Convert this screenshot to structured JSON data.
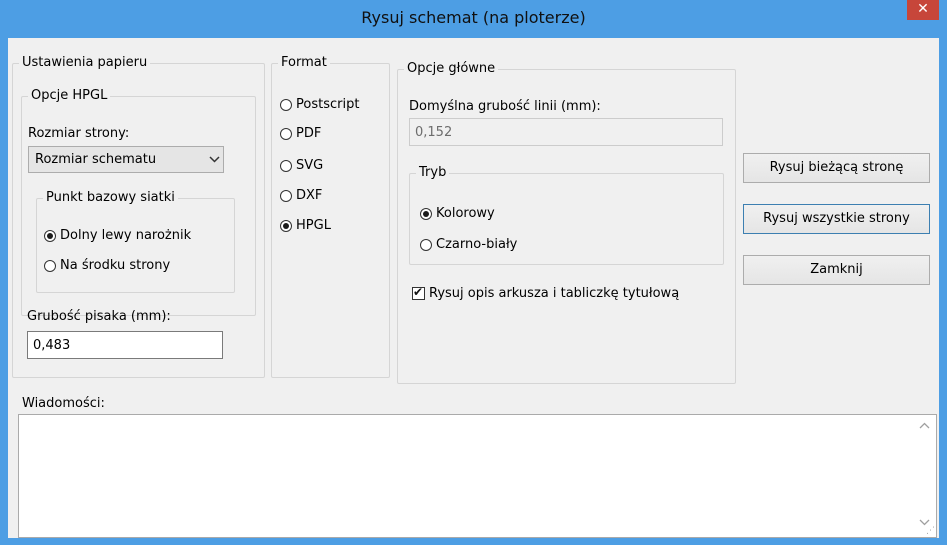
{
  "window": {
    "title": "Rysuj schemat (na ploterze)",
    "close_glyph": "✕"
  },
  "paper": {
    "legend": "Ustawienia papieru",
    "hpgl": {
      "legend": "Opcje HPGL",
      "page_size_label": "Rozmiar strony:",
      "page_size_value": "Rozmiar schematu",
      "grid_origin": {
        "legend": "Punkt bazowy siatki",
        "options": [
          {
            "label": "Dolny lewy narożnik",
            "checked": true
          },
          {
            "label": "Na środku strony",
            "checked": false
          }
        ]
      }
    },
    "pen_width_label": "Grubość pisaka (mm):",
    "pen_width_value": "0,483"
  },
  "format": {
    "legend": "Format",
    "options": [
      {
        "label": "Postscript",
        "checked": false
      },
      {
        "label": "PDF",
        "checked": false
      },
      {
        "label": "SVG",
        "checked": false
      },
      {
        "label": "DXF",
        "checked": false
      },
      {
        "label": "HPGL",
        "checked": true
      }
    ]
  },
  "main_options": {
    "legend": "Opcje główne",
    "line_width_label": "Domyślna grubość linii (mm):",
    "line_width_value": "0,152",
    "mode": {
      "legend": "Tryb",
      "options": [
        {
          "label": "Kolorowy",
          "checked": true
        },
        {
          "label": "Czarno-biały",
          "checked": false
        }
      ]
    },
    "frame_checkbox_label": "Rysuj opis arkusza i tabliczkę tytułową",
    "frame_checkbox_checked": true
  },
  "buttons": {
    "current_page": "Rysuj bieżącą stronę",
    "all_pages": "Rysuj wszystkie strony",
    "close": "Zamknij"
  },
  "messages": {
    "label": "Wiadomości:",
    "text": ""
  },
  "icons": {
    "close": "close-icon",
    "chevron": "chevron-down-icon",
    "scroll_up": "scroll-up-icon",
    "scroll_down": "scroll-down-icon",
    "check": "checkmark-icon"
  }
}
